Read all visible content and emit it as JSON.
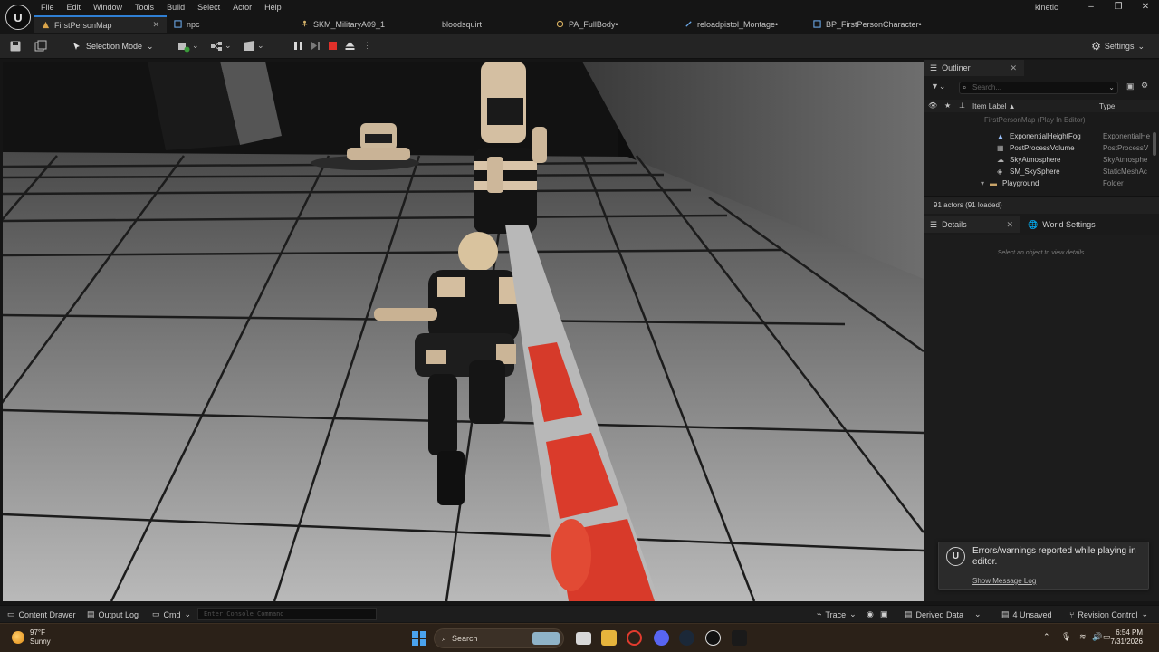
{
  "menu": [
    "File",
    "Edit",
    "Window",
    "Tools",
    "Build",
    "Select",
    "Actor",
    "Help"
  ],
  "project": "kinetic",
  "tabs": [
    "FirstPersonMap",
    "npc",
    "SKM_MilitaryA09_1",
    "bloodsquirt",
    "PA_FullBody•",
    "reloadpistol_Montage•",
    "BP_FirstPersonCharacter•"
  ],
  "toolbar": {
    "mode_label": "Selection Mode",
    "settings_label": "Settings"
  },
  "outliner": {
    "tab_label": "Outliner",
    "search_placeholder": "Search...",
    "col_label": "Item Label ▲",
    "col_type": "Type",
    "root": "FirstPersonMap (Play In Editor)",
    "rows": [
      {
        "label": "ExponentialHeightFog",
        "type": "ExponentialHe"
      },
      {
        "label": "PostProcessVolume",
        "type": "PostProcessV"
      },
      {
        "label": "SkyAtmosphere",
        "type": "SkyAtmosphe"
      },
      {
        "label": "SM_SkySphere",
        "type": "StaticMeshAc"
      },
      {
        "label": "Playground",
        "type": "Folder"
      }
    ],
    "status": "91 actors (91 loaded)"
  },
  "details": {
    "tab_label": "Details",
    "world_tab_label": "World Settings",
    "hint": "Select an object to view details."
  },
  "toast": {
    "message": "Errors/warnings reported while playing in editor.",
    "link": "Show Message Log"
  },
  "bottom": {
    "content_drawer": "Content Drawer",
    "output_log": "Output Log",
    "cmd": "Cmd",
    "console_placeholder": "Enter Console Command",
    "trace": "Trace",
    "derived_data": "Derived Data",
    "unsaved": "4 Unsaved",
    "revision": "Revision Control"
  },
  "taskbar": {
    "temp": "97°F",
    "weather": "Sunny",
    "search": "Search",
    "time": "6:54 PM",
    "date": "7/31/2026"
  },
  "colors": {
    "accent": "#2f7fd4",
    "stop": "#e0302a",
    "taskbar": "#2b2118"
  }
}
